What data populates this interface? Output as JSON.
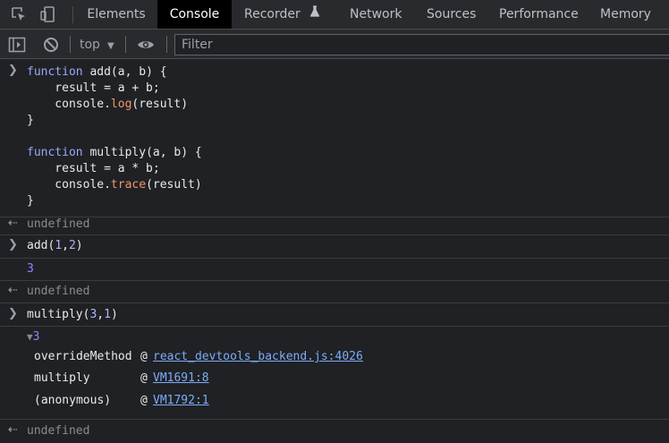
{
  "tabs": [
    {
      "label": "Elements",
      "active": false
    },
    {
      "label": "Console",
      "active": true
    },
    {
      "label": "Recorder",
      "active": false
    },
    {
      "label": "Network",
      "active": false
    },
    {
      "label": "Sources",
      "active": false
    },
    {
      "label": "Performance",
      "active": false
    },
    {
      "label": "Memory",
      "active": false
    }
  ],
  "toolbar": {
    "context": "top",
    "filter_placeholder": "Filter",
    "icons": [
      "sidebar-toggle-icon",
      "clear-console-icon",
      "eye-icon"
    ]
  },
  "console": {
    "input1": {
      "lines": [
        [
          "function",
          " add(a, b) {"
        ],
        [
          "    result = a + b;"
        ],
        [
          "    console.",
          "log",
          "(result)"
        ],
        [
          "}"
        ],
        [],
        [
          "function",
          " multiply(a, b) {"
        ],
        [
          "    result = a * b;"
        ],
        [
          "    console.",
          "trace",
          "(result)"
        ],
        [
          "}"
        ]
      ]
    },
    "result1": "undefined",
    "input2": {
      "fn": "add(",
      "arg1": "1",
      "comma": ",",
      "arg2": "2",
      "close": ")"
    },
    "output2": "3",
    "result2": "undefined",
    "input3": {
      "fn": "multiply(",
      "arg1": "3",
      "comma": ",",
      "arg2": "1",
      "close": ")"
    },
    "trace": {
      "arrow": "▼",
      "value": "3",
      "frames": [
        {
          "name": "overrideMethod",
          "at": "@",
          "link": "react_devtools_backend.js:4026"
        },
        {
          "name": "multiply",
          "at": "@",
          "link": "VM1691:8"
        },
        {
          "name": "(anonymous)",
          "at": "@",
          "link": "VM1792:1"
        }
      ]
    },
    "result3": "undefined"
  },
  "colors": {
    "background": "#202124",
    "toolbar": "#292a2d",
    "keyword": "#9aa7f8",
    "method": "#f29766",
    "number": "#9980ff",
    "link": "#7cacf8",
    "muted": "#8c8c8c"
  }
}
